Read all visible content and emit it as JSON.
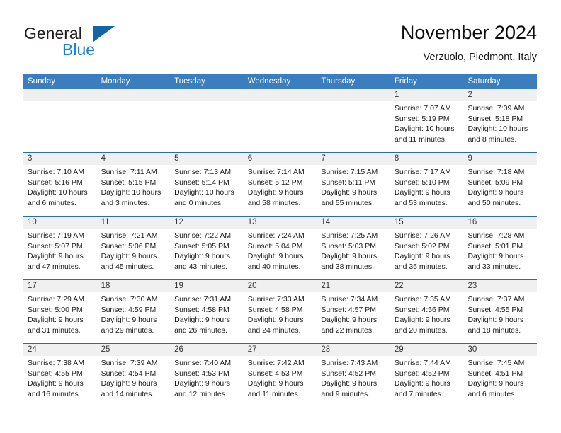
{
  "brand": {
    "name_part1": "General",
    "name_part2": "Blue",
    "triangle_icon": "brand-triangle-icon",
    "accent_color": "#1464a5",
    "blue_text_color": "#1b7fd4"
  },
  "header": {
    "title": "November 2024",
    "subtitle": "Verzuolo, Piedmont, Italy"
  },
  "calendar": {
    "header_bg": "#3a7ebf",
    "row_border_color": "#2e6da4",
    "day_band_bg": "#f0f0f0",
    "weekdays": [
      "Sunday",
      "Monday",
      "Tuesday",
      "Wednesday",
      "Thursday",
      "Friday",
      "Saturday"
    ],
    "weeks": [
      [
        {
          "day": "",
          "sunrise": "",
          "sunset": "",
          "daylight1": "",
          "daylight2": ""
        },
        {
          "day": "",
          "sunrise": "",
          "sunset": "",
          "daylight1": "",
          "daylight2": ""
        },
        {
          "day": "",
          "sunrise": "",
          "sunset": "",
          "daylight1": "",
          "daylight2": ""
        },
        {
          "day": "",
          "sunrise": "",
          "sunset": "",
          "daylight1": "",
          "daylight2": ""
        },
        {
          "day": "",
          "sunrise": "",
          "sunset": "",
          "daylight1": "",
          "daylight2": ""
        },
        {
          "day": "1",
          "sunrise": "Sunrise: 7:07 AM",
          "sunset": "Sunset: 5:19 PM",
          "daylight1": "Daylight: 10 hours",
          "daylight2": "and 11 minutes."
        },
        {
          "day": "2",
          "sunrise": "Sunrise: 7:09 AM",
          "sunset": "Sunset: 5:18 PM",
          "daylight1": "Daylight: 10 hours",
          "daylight2": "and 8 minutes."
        }
      ],
      [
        {
          "day": "3",
          "sunrise": "Sunrise: 7:10 AM",
          "sunset": "Sunset: 5:16 PM",
          "daylight1": "Daylight: 10 hours",
          "daylight2": "and 6 minutes."
        },
        {
          "day": "4",
          "sunrise": "Sunrise: 7:11 AM",
          "sunset": "Sunset: 5:15 PM",
          "daylight1": "Daylight: 10 hours",
          "daylight2": "and 3 minutes."
        },
        {
          "day": "5",
          "sunrise": "Sunrise: 7:13 AM",
          "sunset": "Sunset: 5:14 PM",
          "daylight1": "Daylight: 10 hours",
          "daylight2": "and 0 minutes."
        },
        {
          "day": "6",
          "sunrise": "Sunrise: 7:14 AM",
          "sunset": "Sunset: 5:12 PM",
          "daylight1": "Daylight: 9 hours",
          "daylight2": "and 58 minutes."
        },
        {
          "day": "7",
          "sunrise": "Sunrise: 7:15 AM",
          "sunset": "Sunset: 5:11 PM",
          "daylight1": "Daylight: 9 hours",
          "daylight2": "and 55 minutes."
        },
        {
          "day": "8",
          "sunrise": "Sunrise: 7:17 AM",
          "sunset": "Sunset: 5:10 PM",
          "daylight1": "Daylight: 9 hours",
          "daylight2": "and 53 minutes."
        },
        {
          "day": "9",
          "sunrise": "Sunrise: 7:18 AM",
          "sunset": "Sunset: 5:09 PM",
          "daylight1": "Daylight: 9 hours",
          "daylight2": "and 50 minutes."
        }
      ],
      [
        {
          "day": "10",
          "sunrise": "Sunrise: 7:19 AM",
          "sunset": "Sunset: 5:07 PM",
          "daylight1": "Daylight: 9 hours",
          "daylight2": "and 47 minutes."
        },
        {
          "day": "11",
          "sunrise": "Sunrise: 7:21 AM",
          "sunset": "Sunset: 5:06 PM",
          "daylight1": "Daylight: 9 hours",
          "daylight2": "and 45 minutes."
        },
        {
          "day": "12",
          "sunrise": "Sunrise: 7:22 AM",
          "sunset": "Sunset: 5:05 PM",
          "daylight1": "Daylight: 9 hours",
          "daylight2": "and 43 minutes."
        },
        {
          "day": "13",
          "sunrise": "Sunrise: 7:24 AM",
          "sunset": "Sunset: 5:04 PM",
          "daylight1": "Daylight: 9 hours",
          "daylight2": "and 40 minutes."
        },
        {
          "day": "14",
          "sunrise": "Sunrise: 7:25 AM",
          "sunset": "Sunset: 5:03 PM",
          "daylight1": "Daylight: 9 hours",
          "daylight2": "and 38 minutes."
        },
        {
          "day": "15",
          "sunrise": "Sunrise: 7:26 AM",
          "sunset": "Sunset: 5:02 PM",
          "daylight1": "Daylight: 9 hours",
          "daylight2": "and 35 minutes."
        },
        {
          "day": "16",
          "sunrise": "Sunrise: 7:28 AM",
          "sunset": "Sunset: 5:01 PM",
          "daylight1": "Daylight: 9 hours",
          "daylight2": "and 33 minutes."
        }
      ],
      [
        {
          "day": "17",
          "sunrise": "Sunrise: 7:29 AM",
          "sunset": "Sunset: 5:00 PM",
          "daylight1": "Daylight: 9 hours",
          "daylight2": "and 31 minutes."
        },
        {
          "day": "18",
          "sunrise": "Sunrise: 7:30 AM",
          "sunset": "Sunset: 4:59 PM",
          "daylight1": "Daylight: 9 hours",
          "daylight2": "and 29 minutes."
        },
        {
          "day": "19",
          "sunrise": "Sunrise: 7:31 AM",
          "sunset": "Sunset: 4:58 PM",
          "daylight1": "Daylight: 9 hours",
          "daylight2": "and 26 minutes."
        },
        {
          "day": "20",
          "sunrise": "Sunrise: 7:33 AM",
          "sunset": "Sunset: 4:58 PM",
          "daylight1": "Daylight: 9 hours",
          "daylight2": "and 24 minutes."
        },
        {
          "day": "21",
          "sunrise": "Sunrise: 7:34 AM",
          "sunset": "Sunset: 4:57 PM",
          "daylight1": "Daylight: 9 hours",
          "daylight2": "and 22 minutes."
        },
        {
          "day": "22",
          "sunrise": "Sunrise: 7:35 AM",
          "sunset": "Sunset: 4:56 PM",
          "daylight1": "Daylight: 9 hours",
          "daylight2": "and 20 minutes."
        },
        {
          "day": "23",
          "sunrise": "Sunrise: 7:37 AM",
          "sunset": "Sunset: 4:55 PM",
          "daylight1": "Daylight: 9 hours",
          "daylight2": "and 18 minutes."
        }
      ],
      [
        {
          "day": "24",
          "sunrise": "Sunrise: 7:38 AM",
          "sunset": "Sunset: 4:55 PM",
          "daylight1": "Daylight: 9 hours",
          "daylight2": "and 16 minutes."
        },
        {
          "day": "25",
          "sunrise": "Sunrise: 7:39 AM",
          "sunset": "Sunset: 4:54 PM",
          "daylight1": "Daylight: 9 hours",
          "daylight2": "and 14 minutes."
        },
        {
          "day": "26",
          "sunrise": "Sunrise: 7:40 AM",
          "sunset": "Sunset: 4:53 PM",
          "daylight1": "Daylight: 9 hours",
          "daylight2": "and 12 minutes."
        },
        {
          "day": "27",
          "sunrise": "Sunrise: 7:42 AM",
          "sunset": "Sunset: 4:53 PM",
          "daylight1": "Daylight: 9 hours",
          "daylight2": "and 11 minutes."
        },
        {
          "day": "28",
          "sunrise": "Sunrise: 7:43 AM",
          "sunset": "Sunset: 4:52 PM",
          "daylight1": "Daylight: 9 hours",
          "daylight2": "and 9 minutes."
        },
        {
          "day": "29",
          "sunrise": "Sunrise: 7:44 AM",
          "sunset": "Sunset: 4:52 PM",
          "daylight1": "Daylight: 9 hours",
          "daylight2": "and 7 minutes."
        },
        {
          "day": "30",
          "sunrise": "Sunrise: 7:45 AM",
          "sunset": "Sunset: 4:51 PM",
          "daylight1": "Daylight: 9 hours",
          "daylight2": "and 6 minutes."
        }
      ]
    ]
  }
}
